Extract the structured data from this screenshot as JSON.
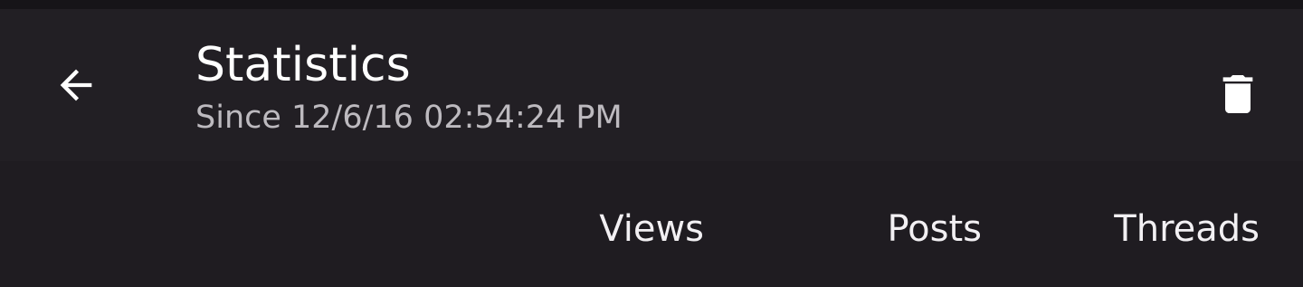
{
  "app_bar": {
    "title": "Statistics",
    "subtitle": "Since 12/6/16 02:54:24 PM",
    "back_icon": "arrow-back-icon",
    "delete_icon": "trash-icon"
  },
  "table_header": {
    "columns": [
      "Views",
      "Posts",
      "Threads"
    ]
  },
  "colors": {
    "background": "#1f1c21",
    "app_bar": "#221f24",
    "text_primary": "#ffffff",
    "text_secondary": "#bdbabf"
  }
}
